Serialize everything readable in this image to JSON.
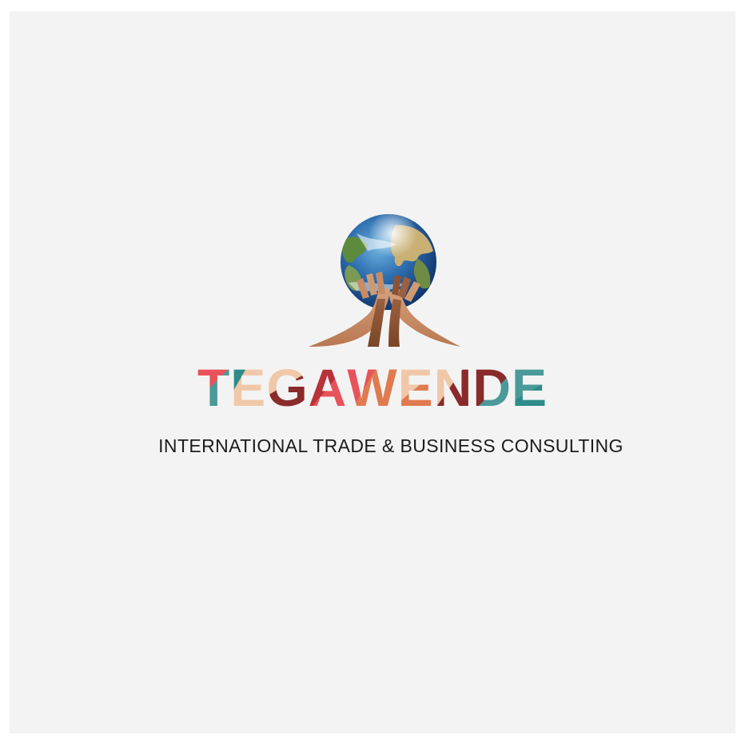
{
  "logo": {
    "icon": "globe-held-by-hands",
    "brand_letters": [
      "T",
      "E",
      "G",
      "A",
      "W",
      "E",
      "N",
      "D",
      "E"
    ],
    "tagline": "INTERNATIONAL TRADE & BUSINESS CONSULTING"
  },
  "colors": {
    "background": "#f3f3f3",
    "tagline": "#1c1c1c",
    "palette": [
      "#e8525a",
      "#4a9a9a",
      "#f0c8a8",
      "#8a2a2a",
      "#e07a50",
      "#2f8a8a"
    ]
  }
}
